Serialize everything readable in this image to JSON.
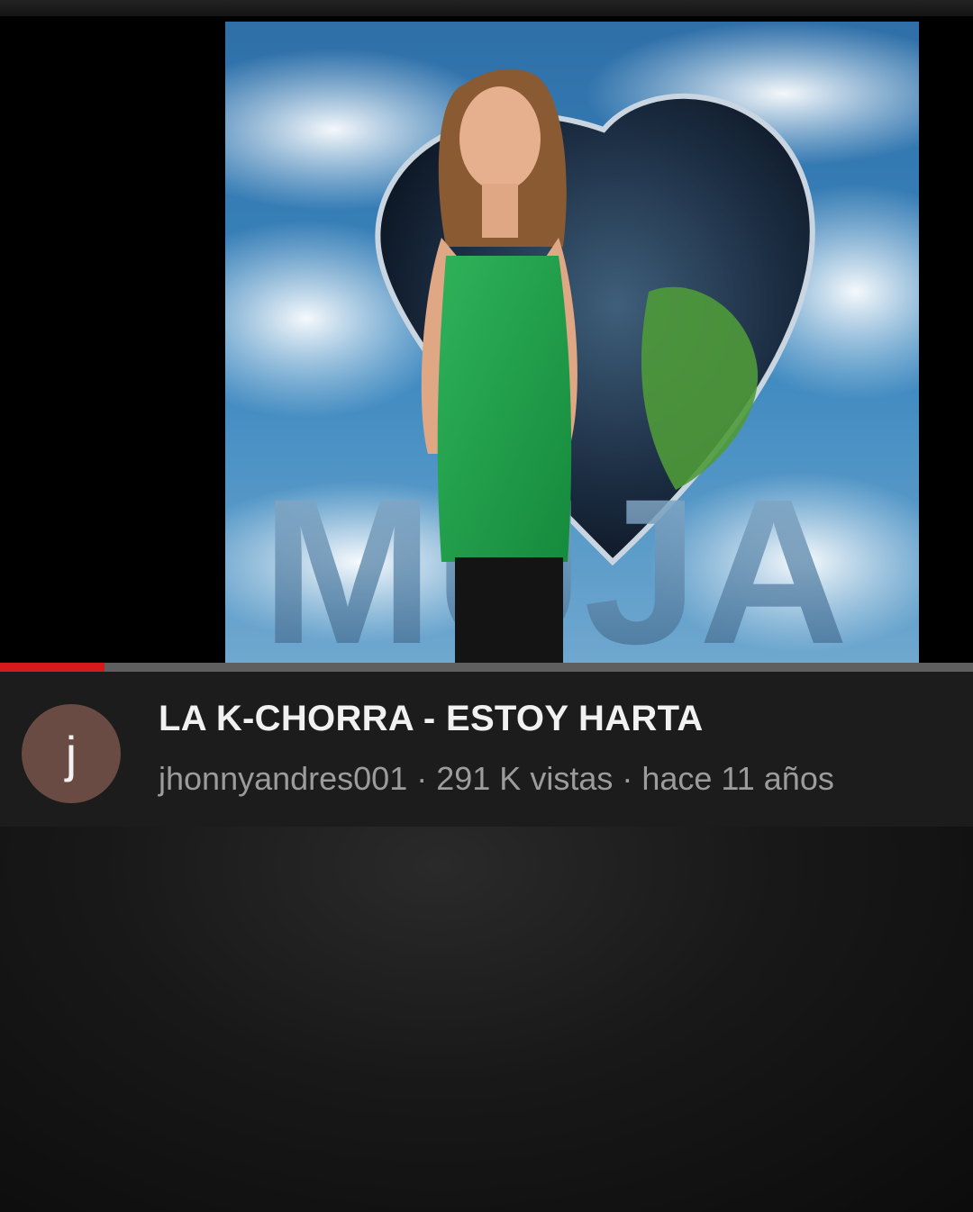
{
  "video": {
    "title": "LA K-CHORRA - ESTOY HARTA",
    "progress": 0.107,
    "thumbnail_text": "MUJA"
  },
  "channel": {
    "avatar_letter": "j",
    "name": "jhonnyandres001"
  },
  "stats": {
    "views": "291 K vistas",
    "separator": "·",
    "uploaded": "hace 11 años"
  },
  "colors": {
    "progress_played": "#d41a1a",
    "progress_track": "#5f5f5f",
    "avatar_bg": "#6a4b43",
    "info_bg": "#1c1c1c"
  }
}
